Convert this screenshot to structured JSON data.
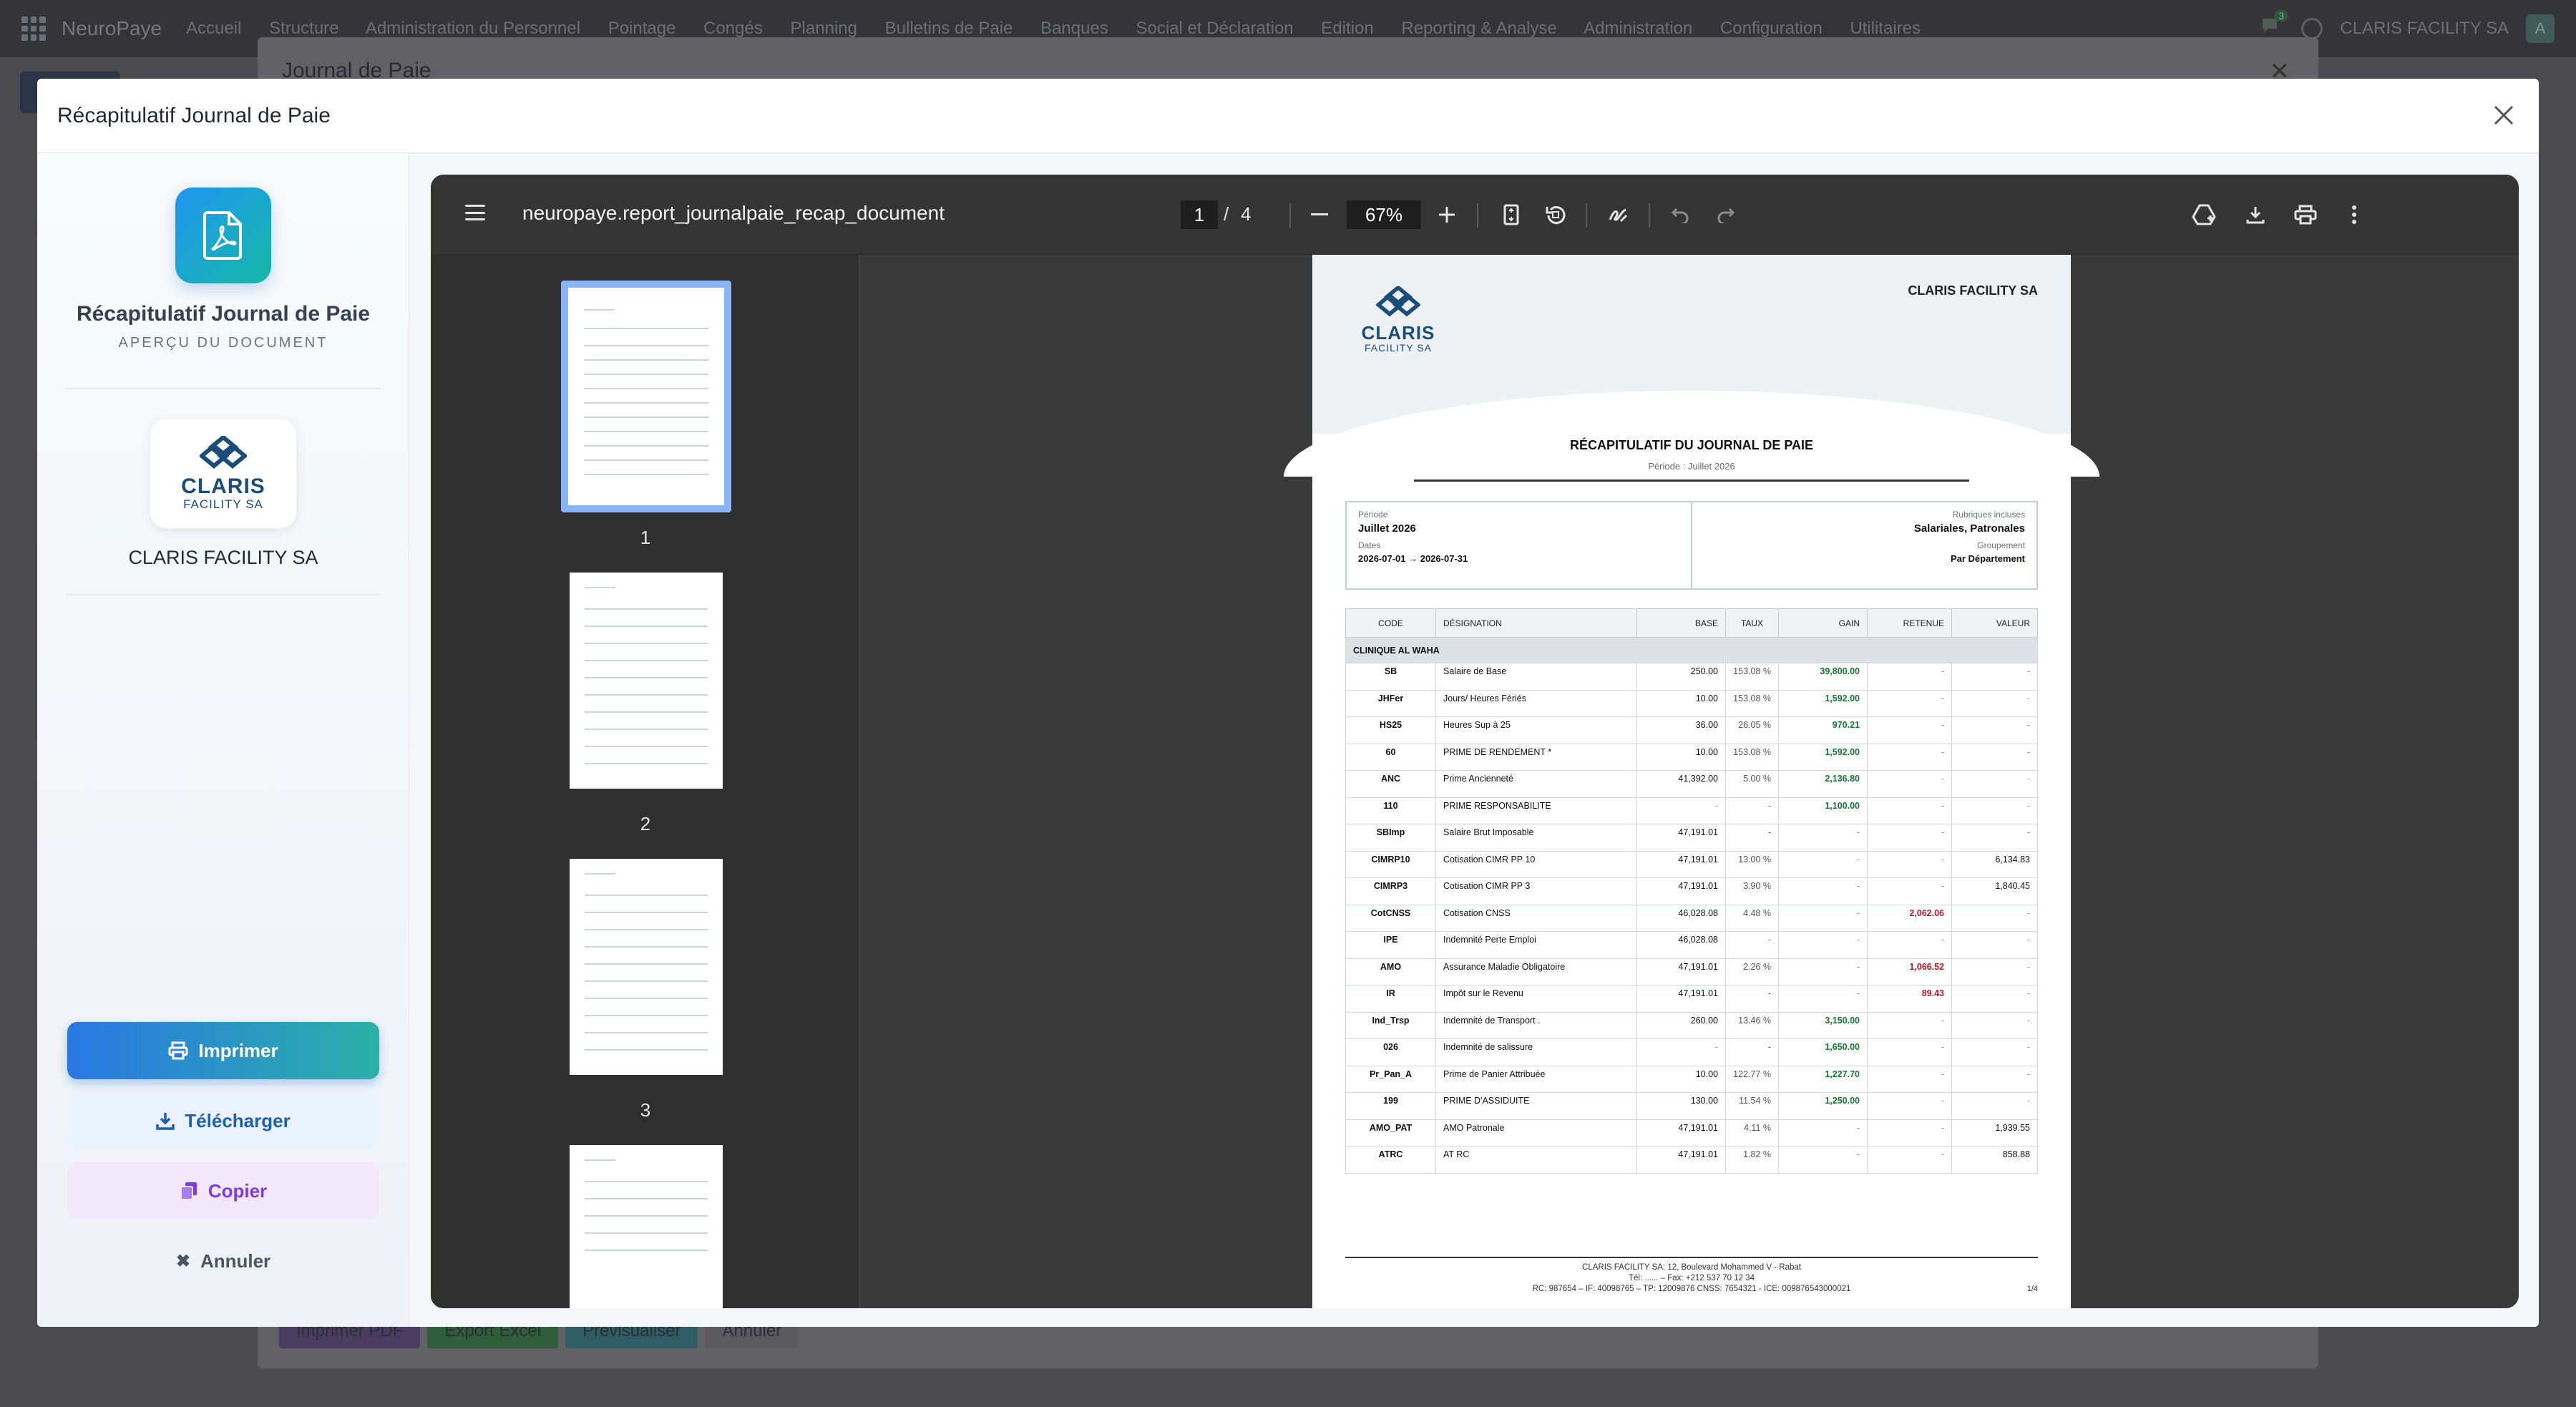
{
  "navbar": {
    "brand": "NeuroPaye",
    "menu": [
      "Accueil",
      "Structure",
      "Administration du Personnel",
      "Pointage",
      "Congés",
      "Planning",
      "Bulletins de Paie",
      "Banques",
      "Social et Déclaration",
      "Edition",
      "Reporting & Analyse",
      "Administration",
      "Configuration",
      "Utilitaires"
    ],
    "chat_badge": "3",
    "company": "CLARIS FACILITY SA",
    "avatar": "A"
  },
  "background_dialog": {
    "title": "Journal de Paie",
    "footer_buttons": [
      "Imprimer PDF",
      "Export Excel",
      "Prévisualiser",
      "Annuler"
    ]
  },
  "modal": {
    "title": "Récapitulatif Journal de Paie",
    "side": {
      "doc_title": "Récapitulatif Journal de Paie",
      "doc_subtitle": "APERÇU DU DOCUMENT",
      "logo_main": "CLARIS",
      "logo_sub": "FACILITY SA",
      "company": "CLARIS FACILITY SA",
      "print_label": "Imprimer",
      "download_label": "Télécharger",
      "copy_label": "Copier",
      "cancel_label": "Annuler"
    }
  },
  "viewer": {
    "filename": "neuropaye.report_journalpaie_recap_document",
    "current_page": "1",
    "total_pages": "4",
    "zoom": "67%",
    "thumbnails": [
      "1",
      "2",
      "3"
    ]
  },
  "page": {
    "company": "CLARIS FACILITY SA",
    "logo_main": "CLARIS",
    "logo_sub": "FACILITY SA",
    "title": "RÉCAPITULATIF DU JOURNAL DE PAIE",
    "period_line": "Période : Juillet 2026",
    "info": {
      "period_label": "Période",
      "period_value": "Juillet 2026",
      "dates_label": "Dates",
      "dates_value": "2026-07-01 → 2026-07-31",
      "rubriques_label": "Rubriques incluses",
      "rubriques_value": "Salariales, Patronales",
      "grouping_label": "Groupement",
      "grouping_value": "Par Département"
    },
    "columns": [
      "CODE",
      "DÉSIGNATION",
      "BASE",
      "TAUX",
      "GAIN",
      "RETENUE",
      "VALEUR"
    ],
    "group": "CLINIQUE AL WAHA",
    "rows": [
      {
        "code": "SB",
        "designation": "Salaire de Base",
        "base": "250.00",
        "taux": "153.08 %",
        "gain": "39,800.00",
        "retenue": "-",
        "valeur": "-"
      },
      {
        "code": "JHFer",
        "designation": "Jours/ Heures Fériés",
        "base": "10.00",
        "taux": "153.08 %",
        "gain": "1,592.00",
        "retenue": "-",
        "valeur": "-"
      },
      {
        "code": "HS25",
        "designation": "Heures Sup à 25",
        "base": "36.00",
        "taux": "26.05 %",
        "gain": "970.21",
        "retenue": "-",
        "valeur": "-"
      },
      {
        "code": "60",
        "designation": "PRIME DE RENDEMENT *",
        "base": "10.00",
        "taux": "153.08 %",
        "gain": "1,592.00",
        "retenue": "-",
        "valeur": "-"
      },
      {
        "code": "ANC",
        "designation": "Prime Ancienneté",
        "base": "41,392.00",
        "taux": "5.00 %",
        "gain": "2,136.80",
        "retenue": "-",
        "valeur": "-"
      },
      {
        "code": "110",
        "designation": "PRIME RESPONSABILITE",
        "base": "-",
        "taux": "-",
        "gain": "1,100.00",
        "retenue": "-",
        "valeur": "-"
      },
      {
        "code": "SBImp",
        "designation": "Salaire Brut Imposable",
        "base": "47,191.01",
        "taux": "-",
        "gain": "-",
        "retenue": "-",
        "valeur": "-"
      },
      {
        "code": "CIMRP10",
        "designation": "Cotisation CIMR PP 10",
        "base": "47,191.01",
        "taux": "13.00 %",
        "gain": "-",
        "retenue": "-",
        "valeur": "6,134.83"
      },
      {
        "code": "CIMRP3",
        "designation": "Cotisation CIMR PP 3",
        "base": "47,191.01",
        "taux": "3.90 %",
        "gain": "-",
        "retenue": "-",
        "valeur": "1,840.45"
      },
      {
        "code": "CotCNSS",
        "designation": "Cotisation CNSS",
        "base": "46,028.08",
        "taux": "4.48 %",
        "gain": "-",
        "retenue": "2,062.06",
        "valeur": "-"
      },
      {
        "code": "IPE",
        "designation": "Indemnité Perte Emploi",
        "base": "46,028.08",
        "taux": "-",
        "gain": "-",
        "retenue": "-",
        "valeur": "-"
      },
      {
        "code": "AMO",
        "designation": "Assurance Maladie Obligatoire",
        "base": "47,191.01",
        "taux": "2.26 %",
        "gain": "-",
        "retenue": "1,066.52",
        "valeur": "-"
      },
      {
        "code": "IR",
        "designation": "Impôt sur le Revenu",
        "base": "47,191.01",
        "taux": "-",
        "gain": "-",
        "retenue": "89.43",
        "valeur": "-"
      },
      {
        "code": "Ind_Trsp",
        "designation": "Indemnité de Transport .",
        "base": "260.00",
        "taux": "13.46 %",
        "gain": "3,150.00",
        "retenue": "-",
        "valeur": "-"
      },
      {
        "code": "026",
        "designation": "Indemnité de salissure",
        "base": "-",
        "taux": "-",
        "gain": "1,650.00",
        "retenue": "-",
        "valeur": "-"
      },
      {
        "code": "Pr_Pan_A",
        "designation": "Prime de Panier Attribuée",
        "base": "10.00",
        "taux": "122.77 %",
        "gain": "1,227.70",
        "retenue": "-",
        "valeur": "-"
      },
      {
        "code": "199",
        "designation": "PRIME D'ASSIDUITE",
        "base": "130.00",
        "taux": "11.54 %",
        "gain": "1,250.00",
        "retenue": "-",
        "valeur": "-"
      },
      {
        "code": "AMO_PAT",
        "designation": "AMO Patronale",
        "base": "47,191.01",
        "taux": "4.11 %",
        "gain": "-",
        "retenue": "-",
        "valeur": "1,939.55"
      },
      {
        "code": "ATRC",
        "designation": "AT RC",
        "base": "47,191.01",
        "taux": "1.82 %",
        "gain": "-",
        "retenue": "-",
        "valeur": "858.88"
      }
    ],
    "footer": {
      "line1": "CLARIS FACILITY SA: 12, Boulevard Mohammed V - Rabat",
      "line2": "Tél: ...... – Fax: +212 537 70 12 34",
      "line3": "RC: 987654 – IF: 40098765 – TP: 12009876 CNSS: 7654321 - ICE: 009876543000021",
      "page": "1/4"
    }
  }
}
